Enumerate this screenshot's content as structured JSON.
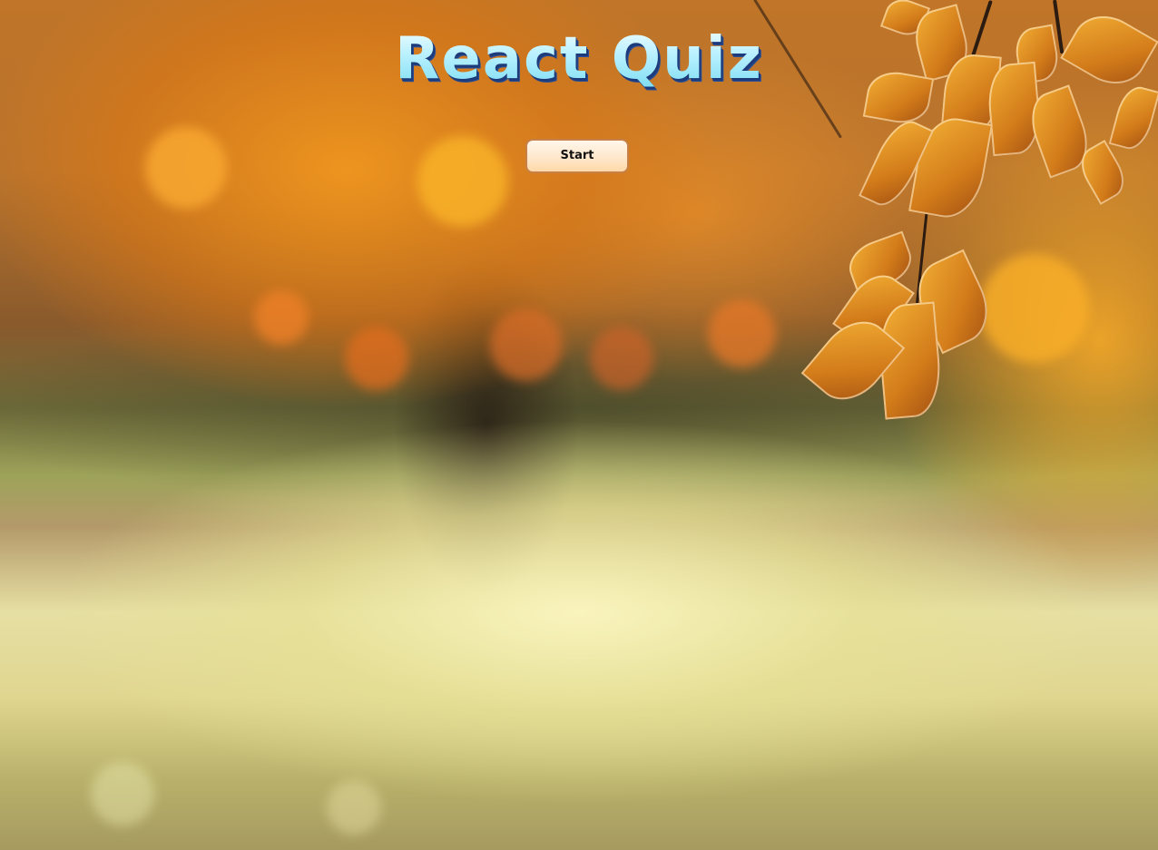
{
  "app": {
    "title": "React Quiz"
  },
  "controls": {
    "start_label": "Start"
  },
  "colors": {
    "title_fill": "#b7f0ff",
    "title_shadow": "#1d3b7a",
    "button_bg": "#ffe9cf",
    "button_border": "#c68048"
  },
  "background": {
    "icon": "autumn-tree-photo"
  }
}
